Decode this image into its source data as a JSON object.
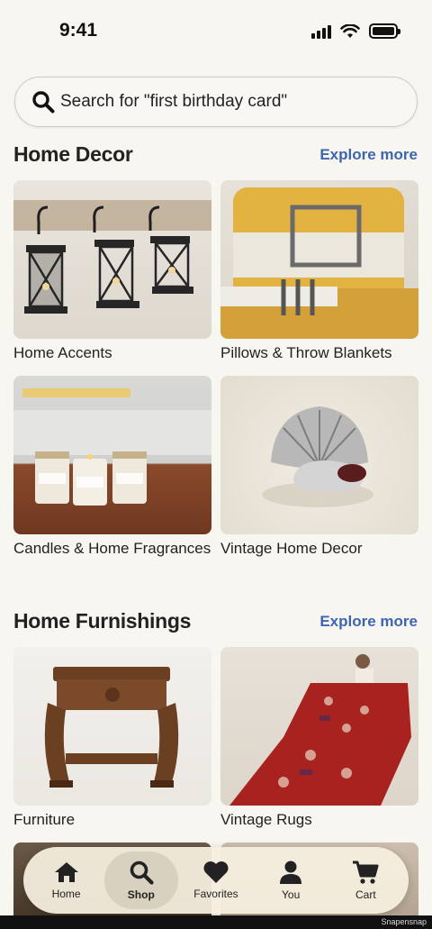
{
  "status_bar": {
    "time": "9:41"
  },
  "search": {
    "placeholder": "Search for \"first birthday card\""
  },
  "sections": [
    {
      "title": "Home Decor",
      "explore": "Explore more",
      "tiles": [
        {
          "label": "Home Accents"
        },
        {
          "label": "Pillows & Throw Blankets"
        },
        {
          "label": "Candles & Home Fragrances"
        },
        {
          "label": "Vintage Home Decor"
        }
      ]
    },
    {
      "title": "Home Furnishings",
      "explore": "Explore more",
      "tiles": [
        {
          "label": "Furniture"
        },
        {
          "label": "Vintage Rugs"
        }
      ]
    }
  ],
  "tabbar": {
    "items": [
      {
        "label": "Home",
        "icon": "home-icon"
      },
      {
        "label": "Shop",
        "icon": "search-icon",
        "active": true
      },
      {
        "label": "Favorites",
        "icon": "heart-icon"
      },
      {
        "label": "You",
        "icon": "person-icon"
      },
      {
        "label": "Cart",
        "icon": "cart-icon"
      }
    ]
  },
  "watermark": "Snapensnap",
  "colors": {
    "background": "#f8f6f1",
    "accent": "#3d66b0",
    "tabbar": "#f5eede"
  }
}
